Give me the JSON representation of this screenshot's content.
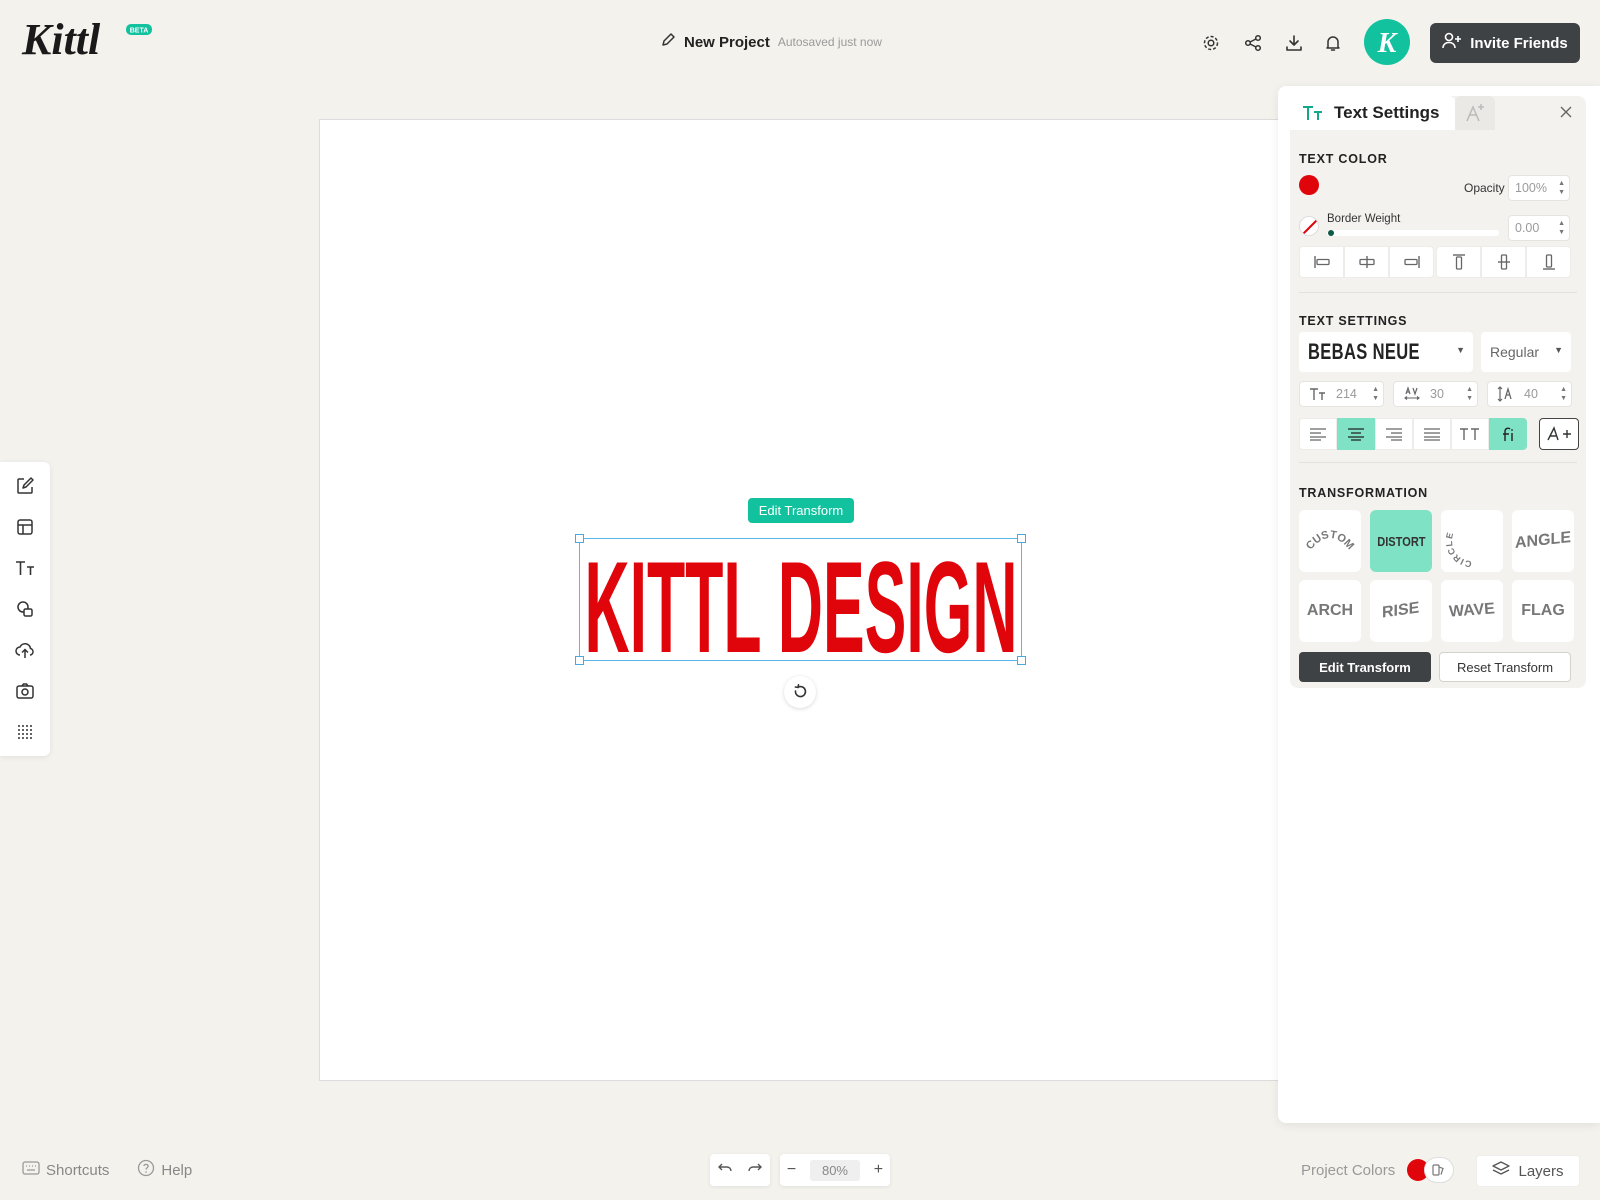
{
  "header": {
    "logo_text": "Kittl",
    "beta_badge": "BETA",
    "project_name": "New Project",
    "autosave_status": "Autosaved just now",
    "invite_label": "Invite Friends",
    "avatar_letter": "K"
  },
  "canvas": {
    "text": "KITTL DESIGN",
    "text_color": "#e0040b",
    "edit_pill": "Edit Transform"
  },
  "panel": {
    "tab_label": "Text Settings",
    "text_color_heading": "TEXT COLOR",
    "opacity_label": "Opacity",
    "opacity_value": "100%",
    "border_weight_label": "Border Weight",
    "border_weight_value": "0.00",
    "text_settings_heading": "TEXT SETTINGS",
    "font_family": "BEBAS NEUE",
    "font_weight": "Regular",
    "font_size": "214",
    "letter_spacing": "30",
    "line_height": "40",
    "transformation_heading": "TRANSFORMATION",
    "transforms": [
      "CUSTOM",
      "DISTORT",
      "CIRCLE",
      "ANGLE",
      "ARCH",
      "RISE",
      "WAVE",
      "FLAG"
    ],
    "active_transform": "DISTORT",
    "edit_transform_label": "Edit Transform",
    "reset_transform_label": "Reset Transform"
  },
  "footer": {
    "shortcuts_label": "Shortcuts",
    "help_label": "Help",
    "zoom_value": "80%",
    "project_colors_label": "Project Colors",
    "layers_label": "Layers"
  },
  "colors": {
    "accent": "#12c29e",
    "accent_light": "#7fe2c4",
    "text_red": "#e0040b",
    "dark_button": "#3f4245"
  }
}
